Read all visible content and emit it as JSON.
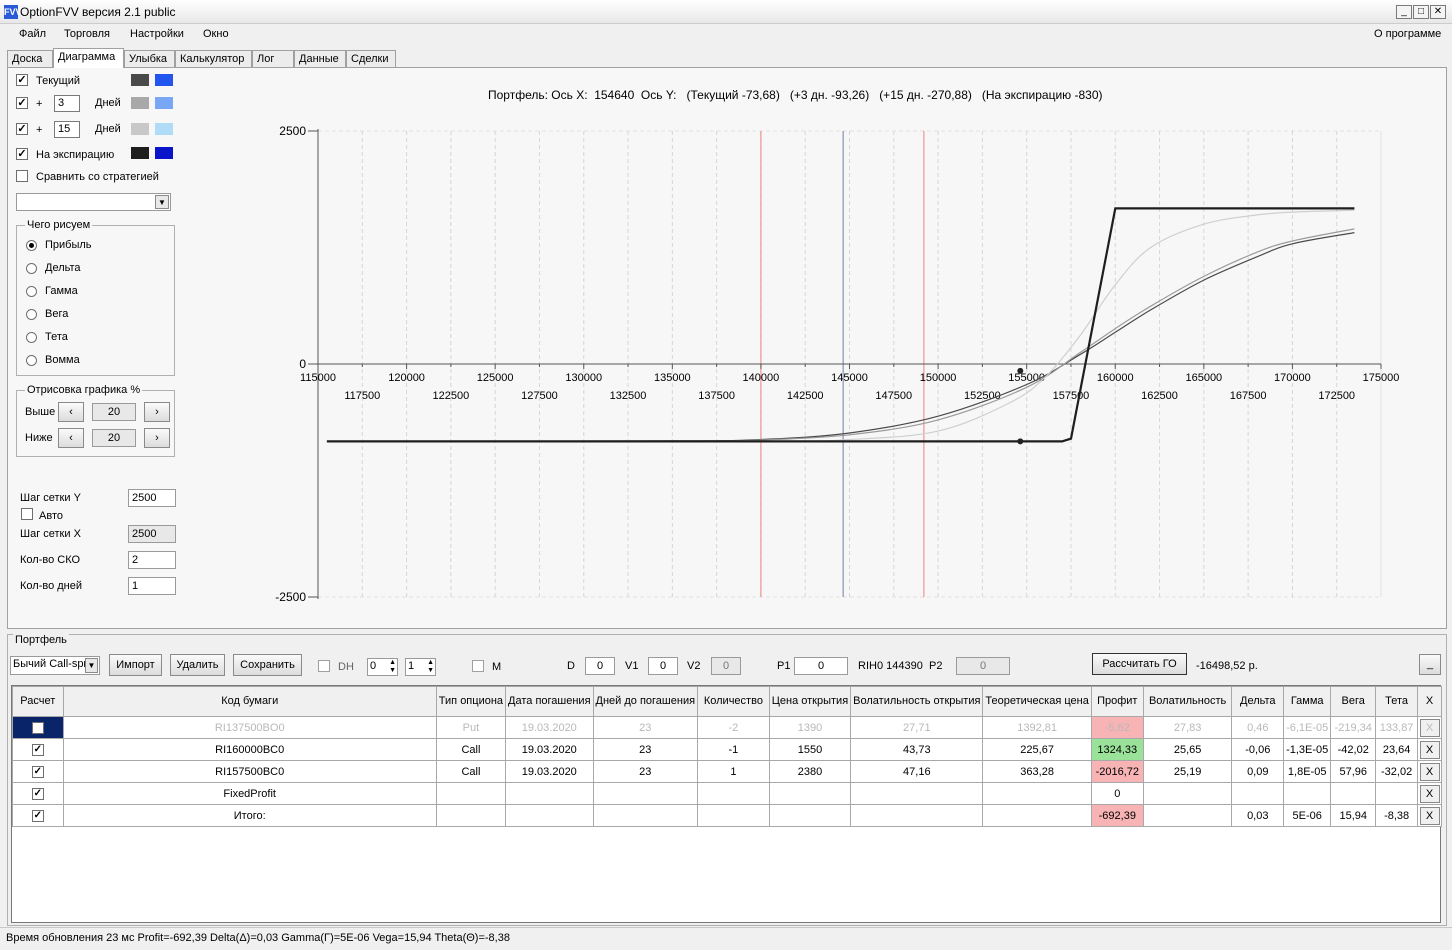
{
  "window": {
    "title": "OptionFVV версия 2.1 public",
    "icon_text": "FVV",
    "minimize": "_",
    "maximize": "□",
    "close": "✕"
  },
  "menu": {
    "items": [
      "Файл",
      "Торговля",
      "Настройки",
      "Окно"
    ],
    "about": "О программе"
  },
  "tabs": [
    "Доска",
    "Диаграмма",
    "Улыбка",
    "Калькулятор",
    "Лог",
    "Данные",
    "Сделки"
  ],
  "active_tab": "Диаграмма",
  "left_panel": {
    "current": {
      "label": "Текущий",
      "checked": true,
      "colors": [
        "#4a4a4a",
        "#2255ee"
      ]
    },
    "plus1": {
      "prefix": "+",
      "days": "3",
      "suffix": "Дней",
      "checked": true,
      "colors": [
        "#a8a8a8",
        "#7aa7f5"
      ]
    },
    "plus2": {
      "prefix": "+",
      "days": "15",
      "suffix": "Дней",
      "checked": true,
      "colors": [
        "#c8c8c8",
        "#b0dcf8"
      ]
    },
    "expiry": {
      "label": "На экспирацию",
      "checked": true,
      "colors": [
        "#1e1e1e",
        "#0a14c8"
      ]
    },
    "compare": {
      "label": "Сравнить со стратегией",
      "checked": false
    },
    "strategy_select": "",
    "draw_group": {
      "title": "Чего рисуем",
      "options": [
        "Прибыль",
        "Дельта",
        "Гамма",
        "Вега",
        "Тета",
        "Вомма"
      ],
      "selected": "Прибыль"
    },
    "render_group": {
      "title": "Отрисовка графика %",
      "above_label": "Выше",
      "above_value": "20",
      "below_label": "Ниже",
      "below_value": "20"
    },
    "grid_y_label": "Шаг сетки Y",
    "grid_y_value": "2500",
    "auto_label": "Авто",
    "auto_checked": false,
    "grid_x_label": "Шаг сетки X",
    "grid_x_value": "2500",
    "sko_label": "Кол-во СКО",
    "sko_value": "2",
    "days_label": "Кол-во дней",
    "days_value": "1"
  },
  "chart_header": "Портфель: Ось X:  154640  Ось Y:   (Текущий -73,68)   (+3 дн. -93,26)   (+15 дн. -270,88)   (На экспирацию -830)",
  "chart_data": {
    "type": "line",
    "x_range": [
      115000,
      175000
    ],
    "y_range": [
      -2500,
      2500
    ],
    "y_ticks": [
      2500,
      0,
      -2500
    ],
    "x_ticks_upper": [
      115000,
      120000,
      125000,
      130000,
      135000,
      140000,
      145000,
      150000,
      155000,
      160000,
      165000,
      170000,
      175000
    ],
    "x_ticks_lower": [
      117500,
      122500,
      127500,
      132500,
      137500,
      142500,
      147500,
      152500,
      157500,
      162500,
      167500,
      172500
    ],
    "vertical_markers": [
      {
        "x": 140000,
        "color": "#f08080"
      },
      {
        "x": 144640,
        "color": "#7080a0"
      },
      {
        "x": 149200,
        "color": "#f08080"
      }
    ],
    "series": [
      {
        "color": "#4a4a4a",
        "points": [
          [
            115500,
            -830
          ],
          [
            135000,
            -825
          ],
          [
            140000,
            -810
          ],
          [
            145000,
            -740
          ],
          [
            150000,
            -560
          ],
          [
            155000,
            -220
          ],
          [
            158000,
            100
          ],
          [
            160000,
            340
          ],
          [
            162000,
            580
          ],
          [
            165000,
            900
          ],
          [
            168000,
            1150
          ],
          [
            170000,
            1290
          ],
          [
            173500,
            1410
          ]
        ]
      },
      {
        "color": "#9a9a9a",
        "points": [
          [
            115500,
            -830
          ],
          [
            135000,
            -828
          ],
          [
            140000,
            -815
          ],
          [
            145000,
            -760
          ],
          [
            150000,
            -600
          ],
          [
            155000,
            -250
          ],
          [
            158000,
            120
          ],
          [
            160000,
            380
          ],
          [
            162000,
            620
          ],
          [
            165000,
            940
          ],
          [
            168000,
            1200
          ],
          [
            170000,
            1320
          ],
          [
            173500,
            1450
          ]
        ]
      },
      {
        "color": "#cfcfcf",
        "points": [
          [
            115500,
            -830
          ],
          [
            140000,
            -828
          ],
          [
            145000,
            -810
          ],
          [
            150000,
            -720
          ],
          [
            154000,
            -420
          ],
          [
            156000,
            -150
          ],
          [
            158000,
            300
          ],
          [
            160000,
            850
          ],
          [
            162000,
            1250
          ],
          [
            165000,
            1500
          ],
          [
            168000,
            1600
          ],
          [
            170000,
            1630
          ],
          [
            173500,
            1650
          ]
        ]
      },
      {
        "color": "#1e1e1e",
        "points": [
          [
            115500,
            -830
          ],
          [
            157000,
            -830
          ],
          [
            157500,
            -800
          ],
          [
            160000,
            1670
          ],
          [
            173500,
            1670
          ]
        ]
      }
    ],
    "markers": [
      {
        "x": 154640,
        "y": -830
      },
      {
        "x": 154640,
        "y": -73.68
      }
    ]
  },
  "portfolio": {
    "title": "Портфель",
    "strategy_select": "Бычий Call-spr",
    "buttons": {
      "import": "Импорт",
      "delete": "Удалить",
      "save": "Сохранить",
      "calc_go": "Рассчитать ГО",
      "minimize": "_"
    },
    "dh_label": "DH",
    "dh_checked": false,
    "spin1": "0",
    "spin2": "1",
    "m_label": "M",
    "m_checked": false,
    "d_label": "D",
    "d_value": "0",
    "v1_label": "V1",
    "v1_value": "0",
    "v2_label": "V2",
    "v2_value": "0",
    "p1_label": "P1",
    "p1_value": "0",
    "rih_label": "RIH0 144390",
    "p2_label": "P2",
    "p2_value": "0",
    "go_value": "-16498,52 р.",
    "columns": [
      "Расчет",
      "Код бумаги",
      "Тип опциона",
      "Дата погашения",
      "Дней до погашения",
      "Количество",
      "Цена открытия",
      "Волатильность открытия",
      "Теоретическая цена",
      "Профит",
      "Волатильность",
      "Дельта",
      "Гамма",
      "Вега",
      "Тета",
      "X"
    ],
    "rows": [
      {
        "checked": false,
        "dim": true,
        "code": "RI137500BO0",
        "type": "Put",
        "date": "19.03.2020",
        "days": "23",
        "qty": "-2",
        "price": "1390",
        "vol_open": "27,71",
        "theor": "1392,81",
        "profit": "-5,62",
        "profit_color": "#f8b4b4",
        "vol": "27,83",
        "delta": "0,46",
        "gamma": "-6,1E-05",
        "vega": "-219,34",
        "theta": "133,87",
        "del": "X"
      },
      {
        "checked": true,
        "dim": false,
        "code": "RI160000BC0",
        "type": "Call",
        "date": "19.03.2020",
        "days": "23",
        "qty": "-1",
        "price": "1550",
        "vol_open": "43,73",
        "theor": "225,67",
        "profit": "1324,33",
        "profit_color": "#9ae29a",
        "vol": "25,65",
        "delta": "-0,06",
        "gamma": "-1,3E-05",
        "vega": "-42,02",
        "theta": "23,64",
        "del": "X"
      },
      {
        "checked": true,
        "dim": false,
        "code": "RI157500BC0",
        "type": "Call",
        "date": "19.03.2020",
        "days": "23",
        "qty": "1",
        "price": "2380",
        "vol_open": "47,16",
        "theor": "363,28",
        "profit": "-2016,72",
        "profit_color": "#f8b4b4",
        "vol": "25,19",
        "delta": "0,09",
        "gamma": "1,8E-05",
        "vega": "57,96",
        "theta": "-32,02",
        "del": "X"
      },
      {
        "checked": true,
        "dim": false,
        "code": "FixedProfit",
        "type": "",
        "date": "",
        "days": "",
        "qty": "",
        "price": "",
        "vol_open": "",
        "theor": "",
        "profit": "0",
        "profit_color": "#ffffff",
        "vol": "",
        "delta": "",
        "gamma": "",
        "vega": "",
        "theta": "",
        "del": "X"
      },
      {
        "checked": true,
        "dim": false,
        "code": "Итого:",
        "type": "",
        "date": "",
        "days": "",
        "qty": "",
        "price": "",
        "vol_open": "",
        "theor": "",
        "profit": "-692,39",
        "profit_color": "#f8b4b4",
        "vol": "",
        "delta": "0,03",
        "gamma": "5E-06",
        "vega": "15,94",
        "theta": "-8,38",
        "del": "X"
      }
    ]
  },
  "status_text": "Время обновления 23 мс  Profit=-692,39 Delta(Δ)=0,03 Gamma(Γ)=5E-06 Vega=15,94 Theta(Θ)=-8,38"
}
